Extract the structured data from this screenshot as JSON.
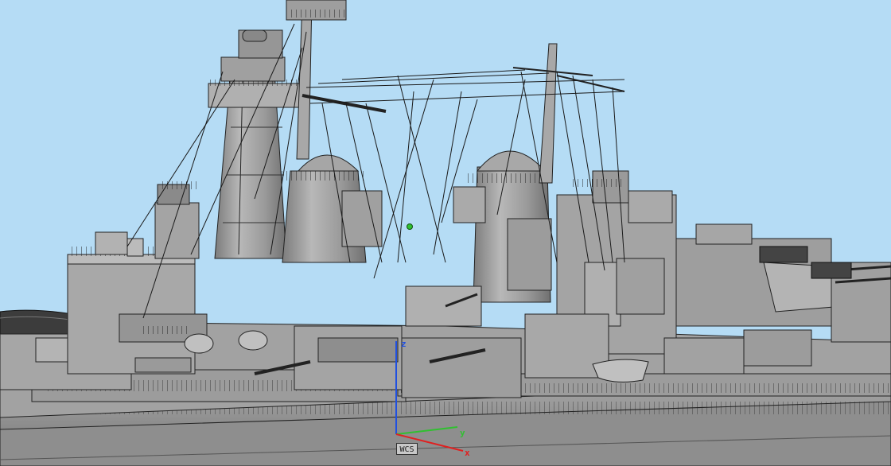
{
  "viewport": {
    "background_color": "#b5dcf5",
    "model_color": "#9a9a9a",
    "edge_color": "#1a1a1a"
  },
  "coordinate_system": {
    "label": "WCS",
    "axis_x_label": "x",
    "axis_y_label": "y",
    "axis_z_label": "z",
    "axis_x_color": "#e02020",
    "axis_y_color": "#30c030",
    "axis_z_color": "#2050e0"
  },
  "pivot_marker_color": "#30c030"
}
